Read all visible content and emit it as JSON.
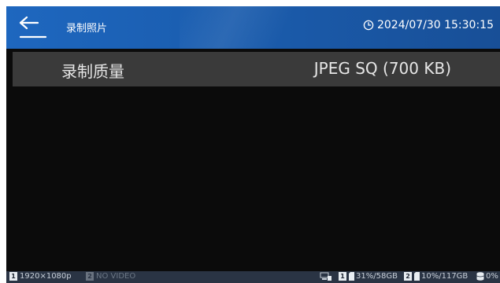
{
  "header": {
    "title": "录制照片",
    "datetime": "2024/07/30 15:30:15"
  },
  "setting": {
    "label": "录制质量",
    "value": "JPEG SQ (700 KB)"
  },
  "status": {
    "input1_badge": "1",
    "input1_resolution": "1920×1080p",
    "input2_badge": "2",
    "input2_text": "NO VIDEO",
    "storage1_badge": "1",
    "storage1_text": "31%/58GB",
    "storage2_badge": "2",
    "storage2_text": "10%/117GB",
    "storage3_text": "0%"
  },
  "colors": {
    "header_blue": "#1e67bf",
    "background": "#0b0b0b",
    "row_gray": "#3a3a3a",
    "statusbar": "#2a3444"
  }
}
